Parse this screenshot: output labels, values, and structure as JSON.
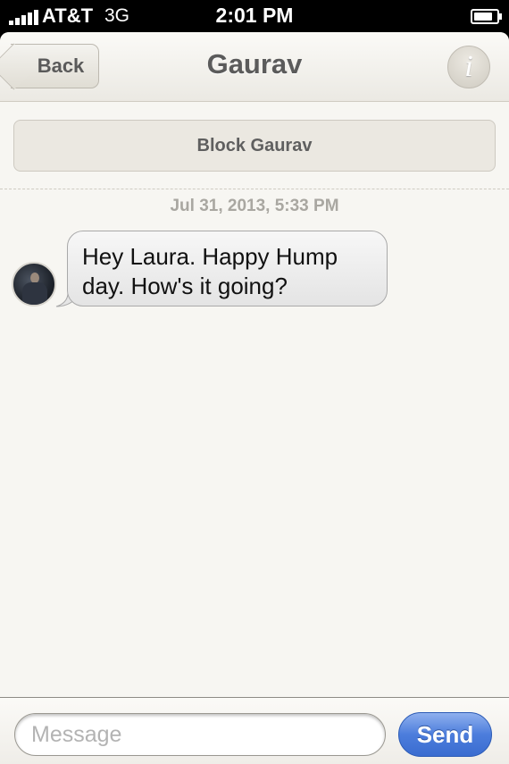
{
  "status_bar": {
    "carrier": "AT&T",
    "network": "3G",
    "time": "2:01 PM"
  },
  "nav": {
    "back_label": "Back",
    "title": "Gaurav",
    "info_icon": "i"
  },
  "block_button_label": "Block Gaurav",
  "conversation": {
    "timestamp": "Jul 31, 2013, 5:33 PM",
    "messages": [
      {
        "sender": "Gaurav",
        "direction": "incoming",
        "line1": "Hey Laura. Happy Hump",
        "line2": "day. How's it going?"
      }
    ]
  },
  "composer": {
    "placeholder": "Message",
    "send_label": "Send"
  },
  "colors": {
    "send_button": "#4c7ddc",
    "background": "#f7f6f2"
  }
}
